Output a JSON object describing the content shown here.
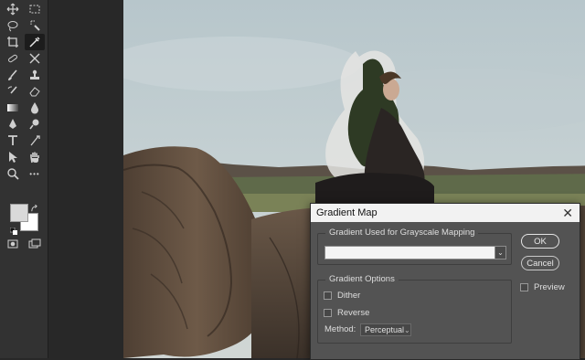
{
  "toolbar": {
    "tools": [
      {
        "name": "move-tool-icon"
      },
      {
        "name": "marquee-tool-icon"
      },
      {
        "name": "lasso-tool-icon"
      },
      {
        "name": "quick-select-tool-icon"
      },
      {
        "name": "crop-tool-icon"
      },
      {
        "name": "eyedropper-tool-icon"
      },
      {
        "name": "healing-brush-tool-icon"
      },
      {
        "name": "patch-tool-icon"
      },
      {
        "name": "brush-tool-icon"
      },
      {
        "name": "clone-stamp-tool-icon"
      },
      {
        "name": "history-brush-tool-icon"
      },
      {
        "name": "eraser-tool-icon"
      },
      {
        "name": "gradient-tool-icon"
      },
      {
        "name": "blur-tool-icon"
      },
      {
        "name": "pen-tool-icon"
      },
      {
        "name": "dodge-tool-icon"
      },
      {
        "name": "type-tool-icon"
      },
      {
        "name": "path-select-tool-icon"
      },
      {
        "name": "direct-select-tool-icon"
      },
      {
        "name": "hand-tool-icon"
      },
      {
        "name": "zoom-tool-icon"
      },
      {
        "name": "more-tools-icon"
      }
    ],
    "more_glyph": "•••",
    "foreground_color": "#d9d9d9",
    "background_color": "#ffffff"
  },
  "dialog": {
    "title": "Gradient Map",
    "close_glyph": "✕",
    "gradient_group_label": "Gradient Used for Grayscale Mapping",
    "gradient_dropdown_glyph": "⌄",
    "options_group_label": "Gradient Options",
    "dither_label": "Dither",
    "dither_checked": false,
    "reverse_label": "Reverse",
    "reverse_checked": false,
    "method_label": "Method:",
    "method_value": "Perceptual",
    "method_chevron": "⌄",
    "ok_label": "OK",
    "cancel_label": "Cancel",
    "preview_label": "Preview",
    "preview_checked": false
  },
  "colors": {
    "app_bg": "#282828",
    "panel_bg": "#323232",
    "dialog_bg": "#535353",
    "titlebar_bg": "#f2f2f2"
  }
}
